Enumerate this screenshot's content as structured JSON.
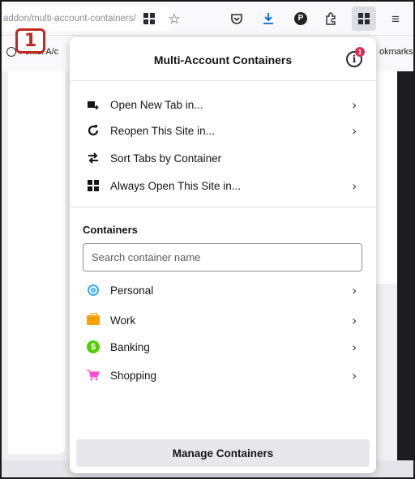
{
  "browser": {
    "url_text": "addon/multi-account-containers/",
    "toolbar_icons": [
      "extension-grid-icon",
      "star-icon",
      "pocket-icon",
      "download-icon",
      "account-icon",
      "extensions-icon",
      "containers-icon",
      "menu-icon"
    ],
    "account_initial": "P",
    "bookmarks_left": "Foxtel A/c",
    "bookmarks_right": "okmarks"
  },
  "annotation": {
    "badge_number": "1",
    "color": "#c2281b"
  },
  "popup": {
    "title": "Multi-Account Containers",
    "info_badge_count": "1",
    "actions": [
      {
        "label": "Open New Tab in...",
        "icon": "new-tab-icon",
        "has_arrow": true
      },
      {
        "label": "Reopen This Site in...",
        "icon": "reopen-icon",
        "has_arrow": true
      },
      {
        "label": "Sort Tabs by Container",
        "icon": "sort-icon",
        "has_arrow": false
      },
      {
        "label": "Always Open This Site in...",
        "icon": "always-open-icon",
        "has_arrow": true
      }
    ],
    "containers_heading": "Containers",
    "search_placeholder": "Search container name",
    "containers": [
      {
        "name": "Personal",
        "icon": "fingerprint-icon",
        "color": "#37adff"
      },
      {
        "name": "Work",
        "icon": "briefcase-icon",
        "color": "#ff9f00"
      },
      {
        "name": "Banking",
        "icon": "dollar-icon",
        "color": "#51cd00"
      },
      {
        "name": "Shopping",
        "icon": "cart-icon",
        "color": "#ff4bda"
      }
    ],
    "manage_label": "Manage Containers"
  }
}
